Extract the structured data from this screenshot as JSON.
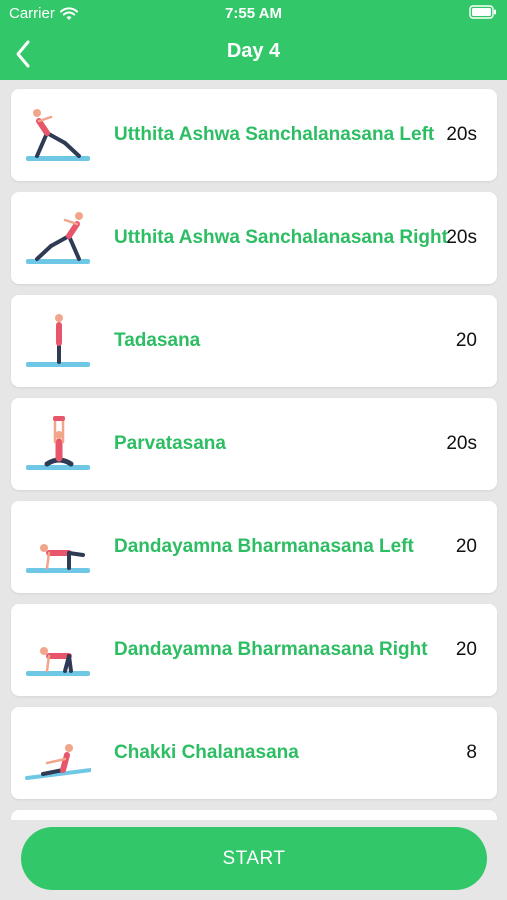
{
  "status": {
    "carrier": "Carrier",
    "time": "7:55 AM"
  },
  "nav": {
    "title": "Day 4"
  },
  "exercises": [
    {
      "name": "Utthita Ashwa Sanchalanasana Left",
      "duration": "20s"
    },
    {
      "name": "Utthita Ashwa Sanchalanasana Right",
      "duration": "20s"
    },
    {
      "name": "Tadasana",
      "duration": "20"
    },
    {
      "name": "Parvatasana",
      "duration": "20s"
    },
    {
      "name": "Dandayamna Bharmanasana Left",
      "duration": "20"
    },
    {
      "name": "Dandayamna Bharmanasana Right",
      "duration": "20"
    },
    {
      "name": "Chakki Chalanasana",
      "duration": "8"
    }
  ],
  "start_label": "START",
  "colors": {
    "accent": "#32c86a",
    "accent_text": "#2dbd63",
    "mat": "#6fc7e6",
    "pose_top": "#e8566b",
    "pose_pants": "#2f3a55"
  }
}
